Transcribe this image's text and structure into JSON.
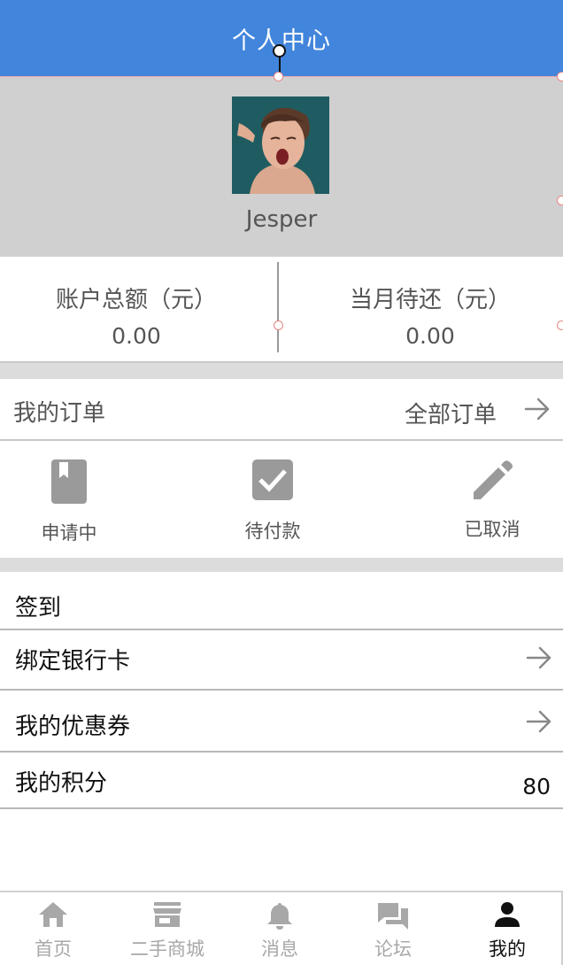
{
  "header": {
    "title": "个人中心"
  },
  "profile": {
    "username": "Jesper"
  },
  "balances": {
    "total_label": "账户总额（元）",
    "total_value": "0.00",
    "due_label": "当月待还（元）",
    "due_value": "0.00"
  },
  "orders": {
    "label": "我的订单",
    "all_label": "全部订单",
    "statuses": [
      {
        "label": "申请中",
        "icon": "bookmark-icon"
      },
      {
        "label": "待付款",
        "icon": "checkbox-icon"
      },
      {
        "label": "已取消",
        "icon": "pencil-icon"
      }
    ]
  },
  "menu": {
    "checkin": "签到",
    "bind_card": "绑定银行卡",
    "coupons": "我的优惠券",
    "points_label": "我的积分",
    "points_value": "80"
  },
  "tabbar": {
    "active_color": "#111111",
    "inactive_color": "#a8a8a8",
    "items": [
      {
        "label": "首页",
        "icon": "home-icon"
      },
      {
        "label": "二手商城",
        "icon": "store-icon"
      },
      {
        "label": "消息",
        "icon": "bell-icon"
      },
      {
        "label": "论坛",
        "icon": "forum-icon"
      },
      {
        "label": "我的",
        "icon": "person-icon",
        "active": true
      }
    ]
  },
  "colors": {
    "header_bg": "#4285dc",
    "profile_bg": "#d0d0d0",
    "section_gap": "#dcdcdc"
  }
}
